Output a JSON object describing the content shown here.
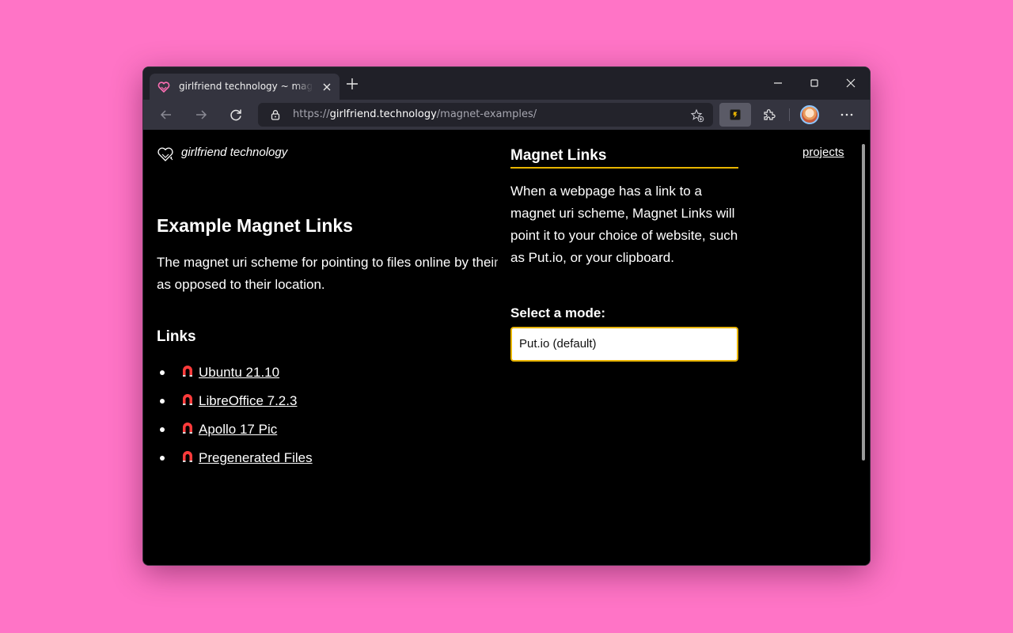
{
  "browser": {
    "tab": {
      "title": "girlfriend technology ~ magnet examples",
      "favicon": "heart-icon"
    },
    "address": {
      "scheme": "https://",
      "host": "girlfriend.technology",
      "path": "/magnet-examples/"
    }
  },
  "site": {
    "name": "girlfriend technology",
    "nav_projects": "projects"
  },
  "page": {
    "heading": "Example Magnet Links",
    "intro": "The magnet uri scheme for pointing to files online by their hash as opposed to their location.",
    "links_heading": "Links",
    "links": [
      {
        "label": "Ubuntu 21.10",
        "icon": "magnet-icon"
      },
      {
        "label": "LibreOffice 7.2.3",
        "icon": "magnet-icon"
      },
      {
        "label": "Apollo 17 Pic",
        "icon": "magnet-icon"
      },
      {
        "label": "Pregenerated Files",
        "icon": "magnet-icon"
      }
    ]
  },
  "popup": {
    "title": "Magnet Links",
    "description": "When a webpage has a link to a magnet uri scheme, Magnet Links will point it to your choice of website, such as Put.io, or your clipboard.",
    "mode_label": "Select a mode:",
    "mode_selected": "Put.io (default)"
  },
  "colors": {
    "background": "#ff74c6",
    "accent": "#e8b400",
    "magnet": "#ff3b3b"
  }
}
